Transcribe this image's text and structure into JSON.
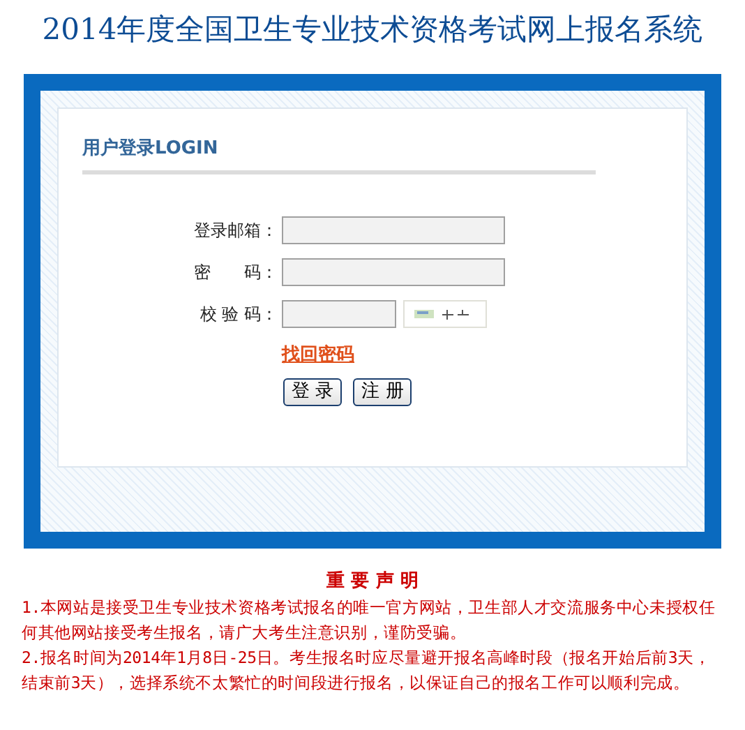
{
  "title": "2014年度全国卫生专业技术资格考试网上报名系统",
  "login": {
    "heading": "用户登录LOGIN",
    "fields": [
      {
        "label": "登录邮箱：",
        "kind": "text"
      },
      {
        "label": "密　　码：",
        "kind": "password"
      },
      {
        "label": "校 验 码：",
        "kind": "captcha"
      }
    ],
    "forgot_link": "找回密码",
    "buttons": [
      {
        "label": "登 录"
      },
      {
        "label": "注 册"
      }
    ]
  },
  "notice": {
    "heading": "重 要 声 明",
    "paragraphs": [
      "1.本网站是接受卫生专业技术资格考试报名的唯一官方网站，卫生部人才交流服务中心未授权任何其他网站接受考生报名，请广大考生注意识别，谨防受骗。",
      "2.报名时间为2014年1月8日-25日。考生报名时应尽量避开报名高峰时段（报名开始后前3天，结束前3天），选择系统不太繁忙的时间段进行报名，以保证自己的报名工作可以顺利完成。"
    ]
  }
}
